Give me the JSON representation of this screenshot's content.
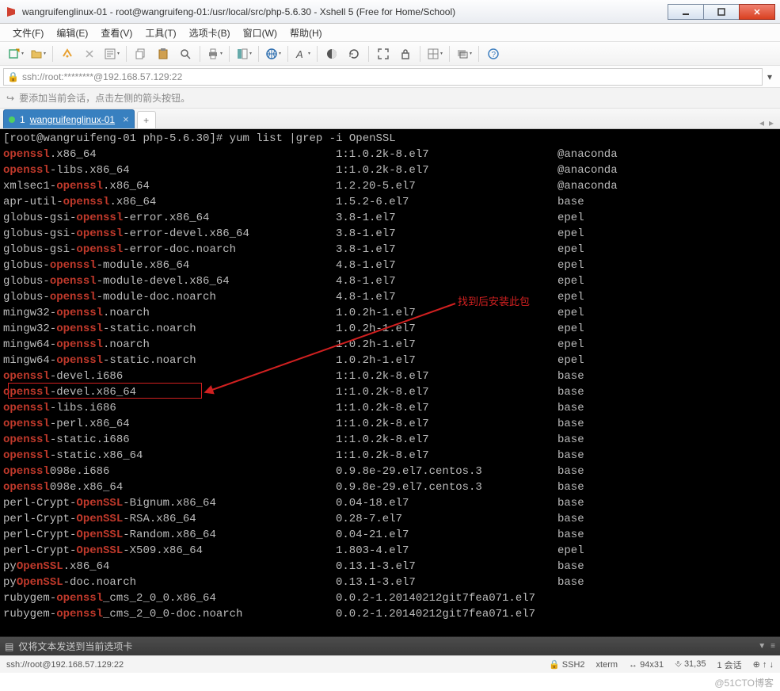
{
  "window": {
    "title": "wangruifenglinux-01 - root@wangruifeng-01:/usr/local/src/php-5.6.30 - Xshell 5 (Free for Home/School)"
  },
  "menu": {
    "file": "文件(F)",
    "edit": "编辑(E)",
    "view": "查看(V)",
    "tools": "工具(T)",
    "tab": "选项卡(B)",
    "window": "窗口(W)",
    "help": "帮助(H)"
  },
  "address": "ssh://root:********@192.168.57.129:22",
  "hint": "要添加当前会话，点击左侧的箭头按钮。",
  "tab": {
    "index": "1",
    "name": "wangruifenglinux-01"
  },
  "prompt": {
    "user": "root@wangruifeng-01",
    "dir": "php-5.6.30",
    "cmd": "yum list |grep -i OpenSSL"
  },
  "packages": [
    {
      "pre": "",
      "hl": "openssl",
      "post": ".x86_64",
      "ver": "1:1.0.2k-8.el7",
      "repo": "@anaconda"
    },
    {
      "pre": "",
      "hl": "openssl",
      "post": "-libs.x86_64",
      "ver": "1:1.0.2k-8.el7",
      "repo": "@anaconda"
    },
    {
      "pre": "xmlsec1-",
      "hl": "openssl",
      "post": ".x86_64",
      "ver": "1.2.20-5.el7",
      "repo": "@anaconda"
    },
    {
      "pre": "apr-util-",
      "hl": "openssl",
      "post": ".x86_64",
      "ver": "1.5.2-6.el7",
      "repo": "base"
    },
    {
      "pre": "globus-gsi-",
      "hl": "openssl",
      "post": "-error.x86_64",
      "ver": "3.8-1.el7",
      "repo": "epel"
    },
    {
      "pre": "globus-gsi-",
      "hl": "openssl",
      "post": "-error-devel.x86_64",
      "ver": "3.8-1.el7",
      "repo": "epel"
    },
    {
      "pre": "globus-gsi-",
      "hl": "openssl",
      "post": "-error-doc.noarch",
      "ver": "3.8-1.el7",
      "repo": "epel"
    },
    {
      "pre": "globus-",
      "hl": "openssl",
      "post": "-module.x86_64",
      "ver": "4.8-1.el7",
      "repo": "epel"
    },
    {
      "pre": "globus-",
      "hl": "openssl",
      "post": "-module-devel.x86_64",
      "ver": "4.8-1.el7",
      "repo": "epel"
    },
    {
      "pre": "globus-",
      "hl": "openssl",
      "post": "-module-doc.noarch",
      "ver": "4.8-1.el7",
      "repo": "epel"
    },
    {
      "pre": "mingw32-",
      "hl": "openssl",
      "post": ".noarch",
      "ver": "1.0.2h-1.el7",
      "repo": "epel"
    },
    {
      "pre": "mingw32-",
      "hl": "openssl",
      "post": "-static.noarch",
      "ver": "1.0.2h-1.el7",
      "repo": "epel"
    },
    {
      "pre": "mingw64-",
      "hl": "openssl",
      "post": ".noarch",
      "ver": "1.0.2h-1.el7",
      "repo": "epel"
    },
    {
      "pre": "mingw64-",
      "hl": "openssl",
      "post": "-static.noarch",
      "ver": "1.0.2h-1.el7",
      "repo": "epel"
    },
    {
      "pre": "",
      "hl": "openssl",
      "post": "-devel.i686",
      "ver": "1:1.0.2k-8.el7",
      "repo": "base"
    },
    {
      "pre": "",
      "hl": "openssl",
      "post": "-devel.x86_64",
      "ver": "1:1.0.2k-8.el7",
      "repo": "base"
    },
    {
      "pre": "",
      "hl": "openssl",
      "post": "-libs.i686",
      "ver": "1:1.0.2k-8.el7",
      "repo": "base"
    },
    {
      "pre": "",
      "hl": "openssl",
      "post": "-perl.x86_64",
      "ver": "1:1.0.2k-8.el7",
      "repo": "base"
    },
    {
      "pre": "",
      "hl": "openssl",
      "post": "-static.i686",
      "ver": "1:1.0.2k-8.el7",
      "repo": "base"
    },
    {
      "pre": "",
      "hl": "openssl",
      "post": "-static.x86_64",
      "ver": "1:1.0.2k-8.el7",
      "repo": "base"
    },
    {
      "pre": "",
      "hl": "openssl",
      "post": "098e.i686",
      "ver": "0.9.8e-29.el7.centos.3",
      "repo": "base"
    },
    {
      "pre": "",
      "hl": "openssl",
      "post": "098e.x86_64",
      "ver": "0.9.8e-29.el7.centos.3",
      "repo": "base"
    },
    {
      "pre": "perl-Crypt-",
      "hl": "OpenSSL",
      "post": "-Bignum.x86_64",
      "ver": "0.04-18.el7",
      "repo": "base"
    },
    {
      "pre": "perl-Crypt-",
      "hl": "OpenSSL",
      "post": "-RSA.x86_64",
      "ver": "0.28-7.el7",
      "repo": "base"
    },
    {
      "pre": "perl-Crypt-",
      "hl": "OpenSSL",
      "post": "-Random.x86_64",
      "ver": "0.04-21.el7",
      "repo": "base"
    },
    {
      "pre": "perl-Crypt-",
      "hl": "OpenSSL",
      "post": "-X509.x86_64",
      "ver": "1.803-4.el7",
      "repo": "epel"
    },
    {
      "pre": "py",
      "hl": "OpenSSL",
      "post": ".x86_64",
      "ver": "0.13.1-3.el7",
      "repo": "base"
    },
    {
      "pre": "py",
      "hl": "OpenSSL",
      "post": "-doc.noarch",
      "ver": "0.13.1-3.el7",
      "repo": "base"
    },
    {
      "pre": "rubygem-",
      "hl": "openssl",
      "post": "_cms_2_0_0.x86_64",
      "ver": "0.0.2-1.20140212git7fea071.el7",
      "repo": ""
    },
    {
      "pre": "rubygem-",
      "hl": "openssl",
      "post": "_cms_2_0_0-doc.noarch",
      "ver": "0.0.2-1.20140212git7fea071.el7",
      "repo": ""
    }
  ],
  "annotation": "找到后安装此包",
  "sendbar": "仅将文本发送到当前选项卡",
  "status": {
    "conn": "ssh://root@192.168.57.129:22",
    "proto": "SSH2",
    "term": "xterm",
    "size": "94x31",
    "pos": "31,35",
    "sessions": "1 会话"
  },
  "watermark": "@51CTO博客"
}
